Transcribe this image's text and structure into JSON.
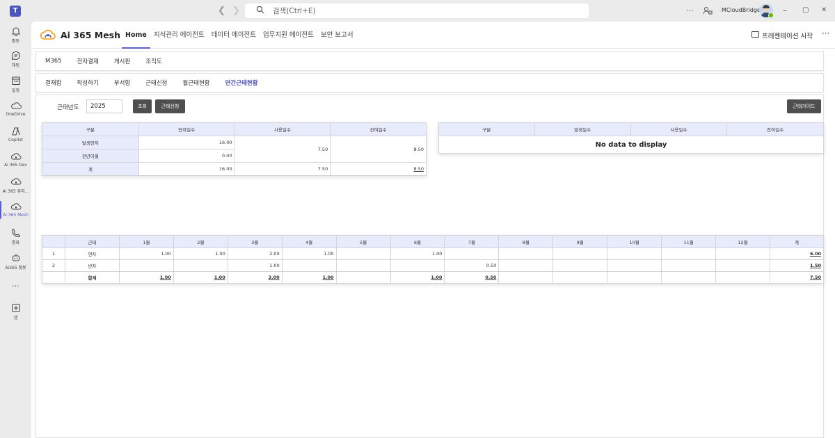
{
  "titlebar": {
    "search_placeholder": "검색(Ctrl+E)",
    "more": "···",
    "user_name": "MCloudBridge",
    "minimize": "–",
    "maximize": "▢",
    "close": "✕"
  },
  "rail": {
    "items": [
      {
        "label": "활동",
        "icon": "bell-icon"
      },
      {
        "label": "채팅",
        "icon": "chat-icon"
      },
      {
        "label": "일정",
        "icon": "calendar-icon"
      },
      {
        "label": "OneDrive",
        "icon": "cloud-icon"
      },
      {
        "label": "Copilot",
        "icon": "copilot-icon"
      },
      {
        "label": "Ai 365 Dev",
        "icon": "ai365-icon"
      },
      {
        "label": "Ai 365 휴지...",
        "icon": "ai365-icon"
      },
      {
        "label": "Ai 365 Mesh",
        "icon": "ai365-icon",
        "active": true
      },
      {
        "label": "통화",
        "icon": "phone-icon"
      },
      {
        "label": "Ai365 챗봇",
        "icon": "bot-icon"
      },
      {
        "label": "···",
        "icon": "more-icon"
      },
      {
        "label": "앱",
        "icon": "add-app-icon"
      }
    ]
  },
  "header": {
    "app_name": "Ai 365 Mesh",
    "tabs": [
      {
        "label": "Home",
        "active": true
      },
      {
        "label": "지식관리 에이전트"
      },
      {
        "label": "데이터 에이전트"
      },
      {
        "label": "업무지원 에이전트"
      },
      {
        "label": "보안 보고서"
      }
    ],
    "present_label": "프레젠테이션 시작",
    "more": "···"
  },
  "menu1": [
    "M365",
    "전자결재",
    "게시판",
    "조직도"
  ],
  "menu2": {
    "items": [
      "결재함",
      "작성하기",
      "부서함",
      "근태신청",
      "월근태현황",
      "연간근태현황"
    ],
    "active_index": 5
  },
  "filter": {
    "year_label": "근태년도",
    "year_value": "2025",
    "search_button": "조회",
    "apply_button": "근태신청",
    "guide_button": "근태가이드"
  },
  "summary_table": {
    "headers": [
      "구분",
      "연차일수",
      "사용일수",
      "잔여일수"
    ],
    "rows": {
      "row1_label": "발생연차",
      "row1_annual": "16.00",
      "row2_label": "전년이월",
      "row2_annual": "0.00",
      "merged_used": "7.50",
      "merged_remain": "8.50",
      "total_label": "계",
      "total_annual": "16.00",
      "total_used": "7.50",
      "total_remain": "8.50"
    }
  },
  "detail_table": {
    "headers": [
      "구분",
      "발생일수",
      "사용일수",
      "잔여일수"
    ],
    "empty_text": "No data to display"
  },
  "monthly_table": {
    "headers": [
      "",
      "근태",
      "1월",
      "2월",
      "3월",
      "4월",
      "5월",
      "6월",
      "7월",
      "8월",
      "9월",
      "10월",
      "11월",
      "12월",
      "계"
    ],
    "rows": [
      {
        "no": "1",
        "type": "연차",
        "months": [
          "1.00",
          "1.00",
          "2.00",
          "1.00",
          "",
          "1.00",
          "",
          "",
          "",
          "",
          "",
          ""
        ],
        "total": "6.00"
      },
      {
        "no": "2",
        "type": "반차",
        "months": [
          "",
          "",
          "1.00",
          "",
          "",
          "",
          "0.50",
          "",
          "",
          "",
          "",
          ""
        ],
        "total": "1.50"
      },
      {
        "no": "",
        "type": "합계",
        "months": [
          "1.00",
          "1.00",
          "3.00",
          "1.00",
          "",
          "1.00",
          "0.50",
          "",
          "",
          "",
          "",
          ""
        ],
        "total": "7.50"
      }
    ]
  }
}
